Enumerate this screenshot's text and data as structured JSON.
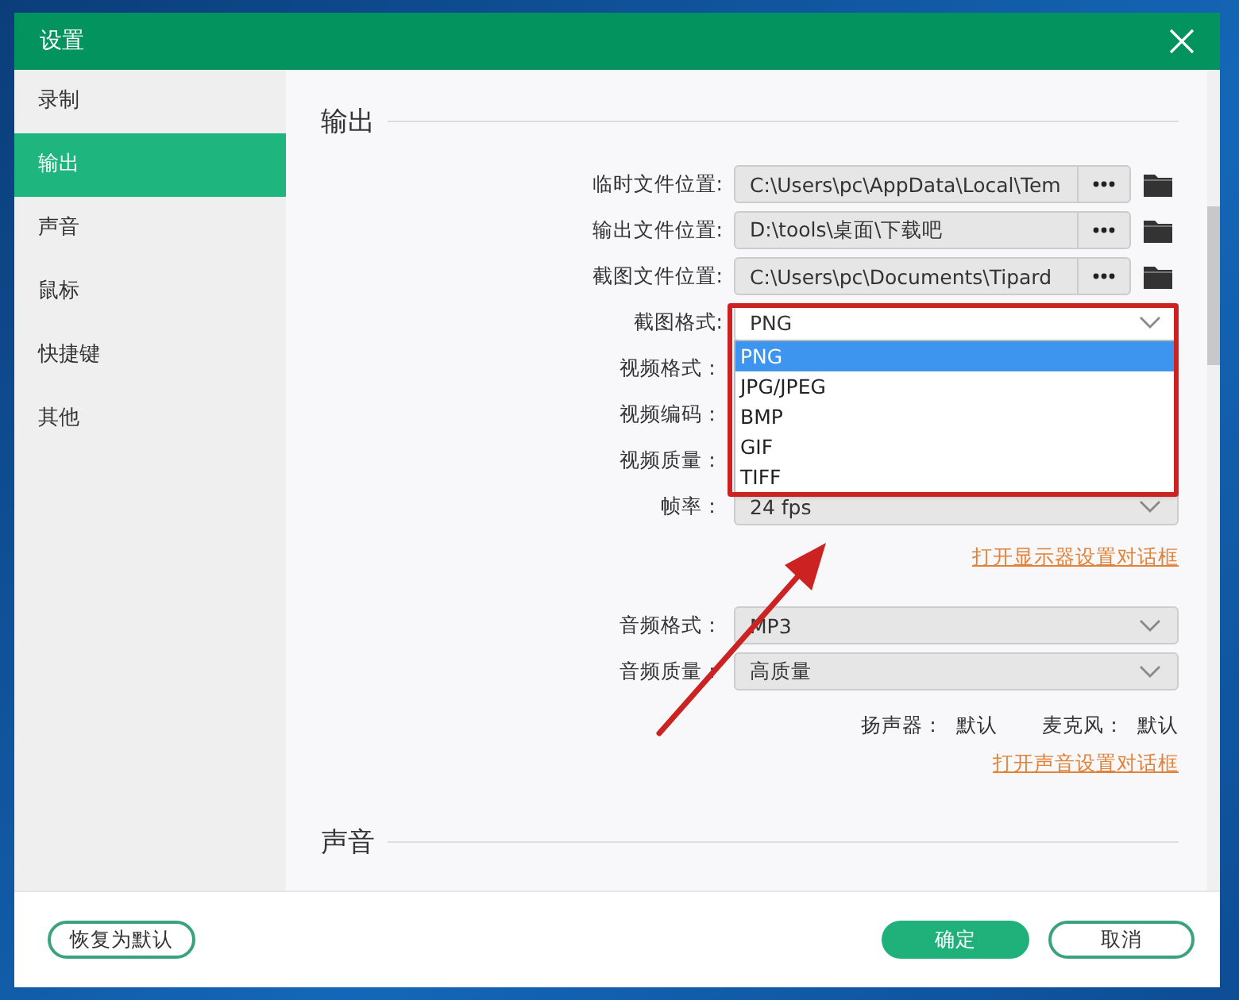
{
  "window": {
    "title": "设置"
  },
  "sidebar": {
    "items": [
      {
        "label": "录制",
        "selected": false
      },
      {
        "label": "输出",
        "selected": true
      },
      {
        "label": "声音",
        "selected": false
      },
      {
        "label": "鼠标",
        "selected": false
      },
      {
        "label": "快捷键",
        "selected": false
      },
      {
        "label": "其他",
        "selected": false
      }
    ]
  },
  "output": {
    "heading": "输出",
    "rows": [
      {
        "kind": "path",
        "label": "临时文件位置:",
        "value": "C:\\Users\\pc\\AppData\\Local\\Tem"
      },
      {
        "kind": "path",
        "label": "输出文件位置:",
        "value": "D:\\tools\\桌面\\下载吧"
      },
      {
        "kind": "path",
        "label": "截图文件位置:",
        "value": "C:\\Users\\pc\\Documents\\Tipard"
      },
      {
        "kind": "select",
        "label": "截图格式:",
        "value": "PNG"
      },
      {
        "kind": "covered",
        "label": "视频格式："
      },
      {
        "kind": "covered",
        "label": "视频编码："
      },
      {
        "kind": "covered",
        "label": "视频质量："
      },
      {
        "kind": "select",
        "label": "帧率：",
        "value": "24 fps"
      }
    ],
    "link": "打开显示器设置对话框",
    "audio_rows": [
      {
        "kind": "select",
        "label": "音频格式：",
        "value": "MP3"
      },
      {
        "kind": "select",
        "label": "音频质量：",
        "value": "高质量"
      }
    ],
    "devices": [
      {
        "label": "扬声器：",
        "value": "默认"
      },
      {
        "label": "麦克风：",
        "value": "默认"
      }
    ],
    "audio_link": "打开声音设置对话框"
  },
  "format_dropdown": {
    "options": [
      {
        "label": "PNG",
        "selected": true
      },
      {
        "label": "JPG/JPEG",
        "selected": false
      },
      {
        "label": "BMP",
        "selected": false
      },
      {
        "label": "GIF",
        "selected": false
      },
      {
        "label": "TIFF",
        "selected": false
      }
    ]
  },
  "sound": {
    "heading": "声音"
  },
  "footer": {
    "reset": "恢复为默认",
    "ok": "确定",
    "cancel": "取消"
  }
}
